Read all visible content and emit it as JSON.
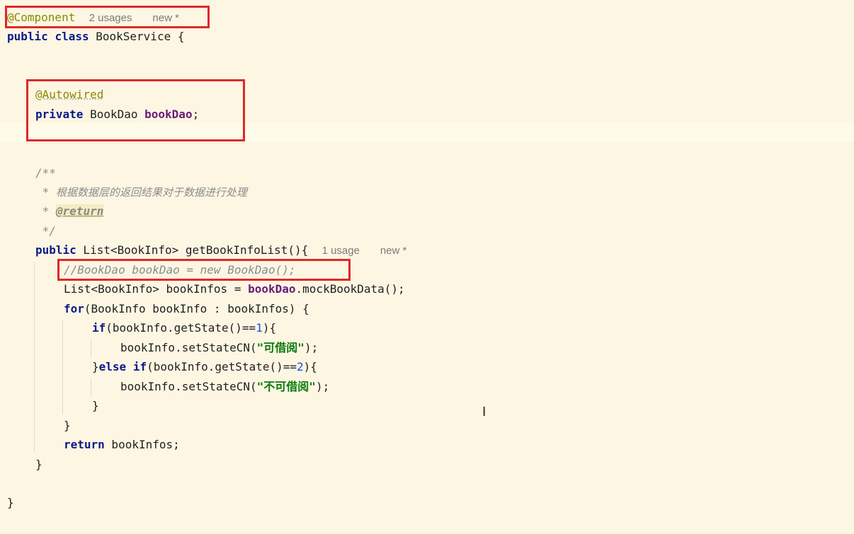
{
  "code": {
    "l1_annotation": "@Component",
    "l1_hint_usages": "2 usages",
    "l1_hint_new": "new *",
    "l2_kw_public": "public",
    "l2_kw_class": "class",
    "l2_rest": " BookService {",
    "l5_annotation": "@Autowired",
    "l6_kw_private": "private",
    "l6_type": " BookDao ",
    "l6_field": "bookDao",
    "l6_semi": ";",
    "l9_doc_open": "/**",
    "l10_doc_star": " * ",
    "l10_doc_text": "根据数据层的返回结果对于数据进行处理",
    "l11_doc_star": " * ",
    "l11_doc_tag": "@return",
    "l12_doc_close": " */",
    "l13_kw_public": "public",
    "l13_rest": " List<BookInfo> getBookInfoList(){",
    "l13_hint_usages": "1 usage",
    "l13_hint_new": "new *",
    "l14_comment": "//BookDao bookDao = new BookDao();",
    "l15_pre": "List<BookInfo> bookInfos = ",
    "l15_field": "bookDao",
    "l15_post": ".mockBookData();",
    "l16_kw_for": "for",
    "l16_rest": "(BookInfo bookInfo : bookInfos) {",
    "l17_kw_if": "if",
    "l17_pre": "(bookInfo.getState()==",
    "l17_num": "1",
    "l17_post": "){",
    "l18_pre": "bookInfo.setStateCN(",
    "l18_str": "\"可借阅\"",
    "l18_post": ");",
    "l19_brace": "}",
    "l19_kw_else": "else",
    "l19_kw_if": "if",
    "l19_pre": "(bookInfo.getState()==",
    "l19_num": "2",
    "l19_post": "){",
    "l20_pre": "bookInfo.setStateCN(",
    "l20_str": "\"不可借阅\"",
    "l20_post": ");",
    "l21_brace": "}",
    "l22_brace": "}",
    "l23_kw_return": "return",
    "l23_rest": " bookInfos;",
    "l24_brace": "}",
    "l26_brace": "}"
  },
  "colors": {
    "background": "#fdf6e3",
    "keyword": "#0b1a8a",
    "annotation": "#8a8a00",
    "field": "#6a1b7a",
    "string": "#0a7a0a",
    "number": "#1750eb",
    "comment": "#8c8c8c",
    "highlight_box": "#e02828"
  },
  "icons": {
    "mouse_cursor": "text-cursor-icon"
  }
}
